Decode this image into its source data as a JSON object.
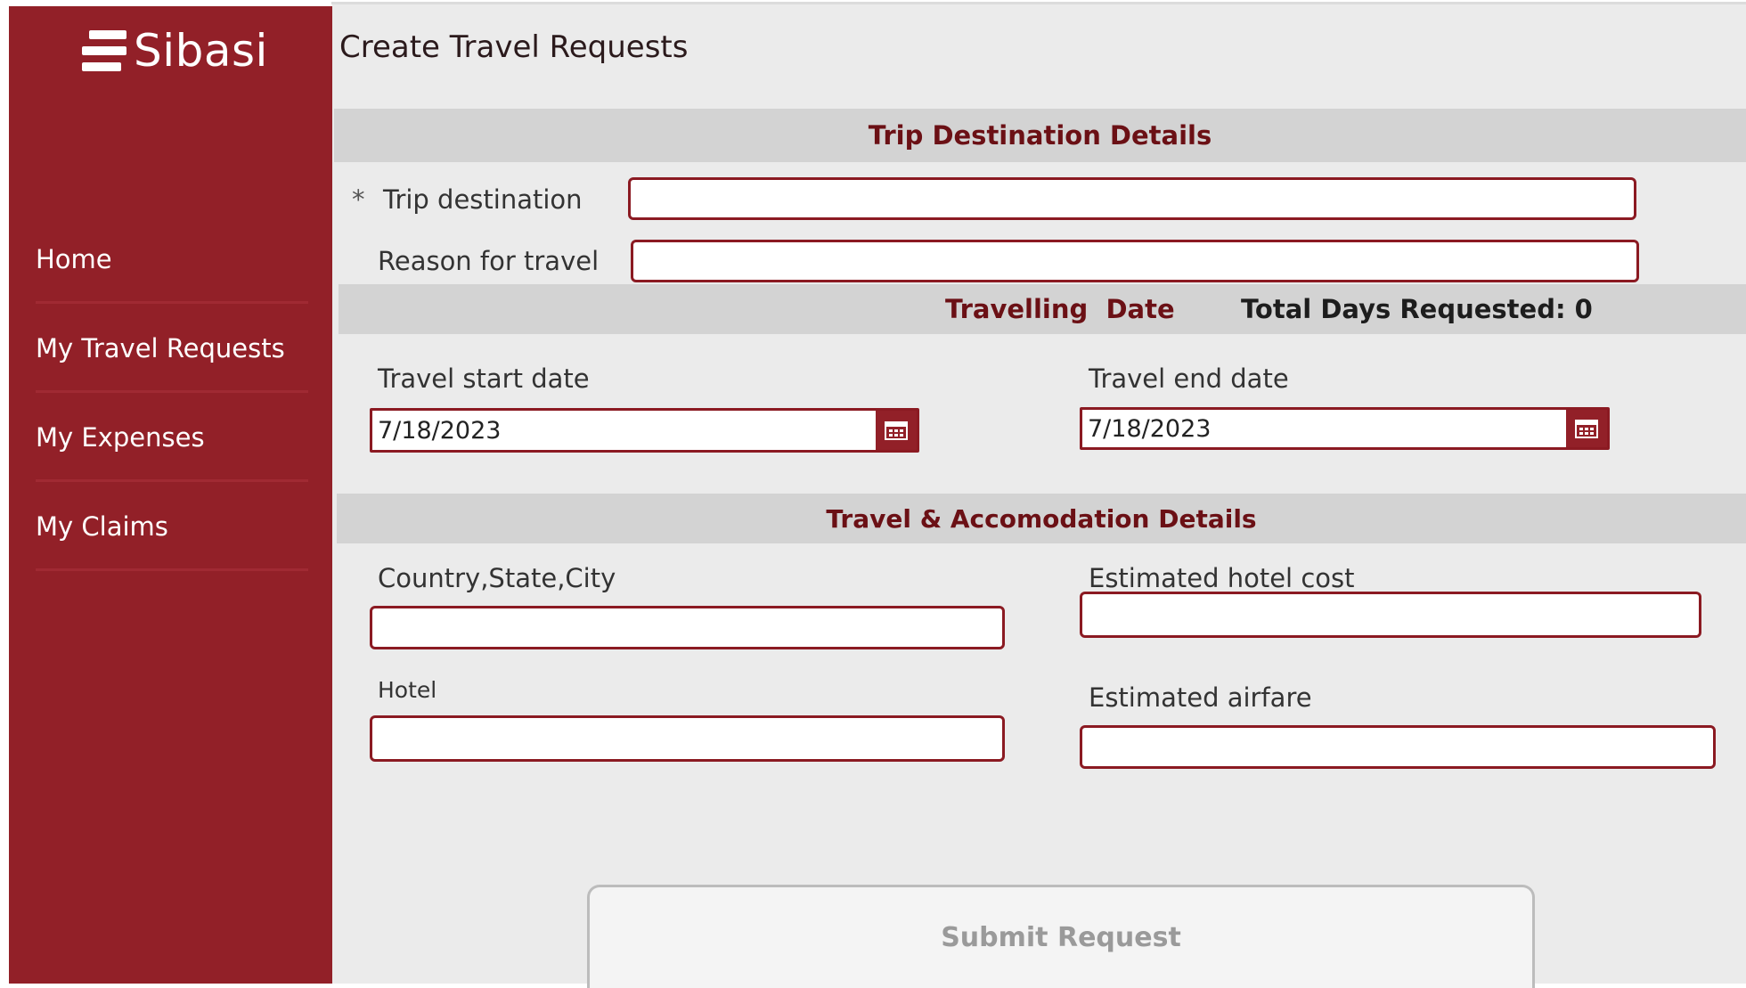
{
  "app": {
    "logo_text": "Sibasi"
  },
  "sidebar": {
    "items": [
      {
        "label": "Home"
      },
      {
        "label": "My Travel Requests"
      },
      {
        "label": "My Expenses"
      },
      {
        "label": "My Claims"
      }
    ]
  },
  "page": {
    "title": "Create Travel Requests"
  },
  "trip_section": {
    "title": "Trip Destination Details",
    "destination": {
      "required_marker": "*",
      "label": "Trip destination",
      "value": ""
    },
    "reason": {
      "label": "Reason for travel",
      "value": ""
    }
  },
  "dates_section": {
    "title": "Travelling  Date",
    "total_days_label": "Total Days Requested: 0",
    "start": {
      "label": "Travel start date",
      "value": "7/18/2023"
    },
    "end": {
      "label": "Travel end date",
      "value": "7/18/2023"
    }
  },
  "accommodation_section": {
    "title": "Travel & Accomodation Details",
    "location": {
      "label": "Country,State,City",
      "value": ""
    },
    "hotel": {
      "label": "Hotel",
      "value": ""
    },
    "hotel_cost": {
      "label": "Estimated hotel cost",
      "value": ""
    },
    "airfare": {
      "label": "Estimated airfare",
      "value": ""
    }
  },
  "actions": {
    "submit_label": "Submit Request"
  },
  "colors": {
    "brand": "#922028",
    "border": "#8b1a22",
    "band": "#d3d3d3",
    "background": "#ebebeb"
  }
}
